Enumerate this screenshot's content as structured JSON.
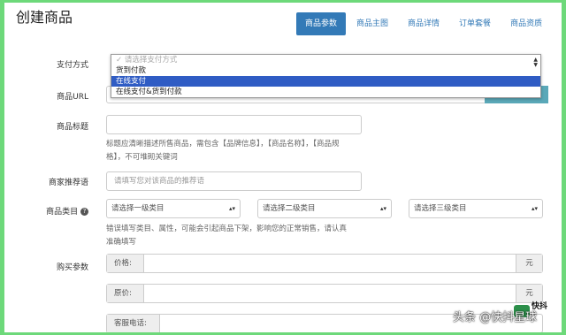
{
  "page": {
    "title": "创建商品"
  },
  "tabs": [
    {
      "label": "商品参数"
    },
    {
      "label": "商品主图"
    },
    {
      "label": "商品详情"
    },
    {
      "label": "订单套餐"
    },
    {
      "label": "商品资质"
    }
  ],
  "form": {
    "payment": {
      "label": "支付方式",
      "options": [
        "请选择支付方式",
        "货到付款",
        "在线支付",
        "在线支付&货到付款"
      ],
      "highlighted": "在线支付"
    },
    "url": {
      "label": "商品URL"
    },
    "title": {
      "label": "商品标题",
      "help": "标题应清晰描述所售商品，需包含【品牌信息】，【商品名称】，【商品规格】，不可堆砌关键词"
    },
    "recommend": {
      "label": "商家推荐语",
      "placeholder": "请填写您对该商品的推荐语"
    },
    "category": {
      "label": "商品类目",
      "level1": "请选择一级类目",
      "level2": "请选择二级类目",
      "level3": "请选择三级类目",
      "help": "错误填写类目、属性，可能会引起商品下架，影响您的正常销售，请认真准确填写"
    },
    "purchase": {
      "label": "购买参数",
      "price_label": "价格:",
      "price_unit": "元",
      "original_label": "原价:",
      "original_unit": "元",
      "phone_label": "客服电话:"
    }
  },
  "watermark": {
    "text": "头条 @快抖星球",
    "logo_text": "快抖"
  }
}
